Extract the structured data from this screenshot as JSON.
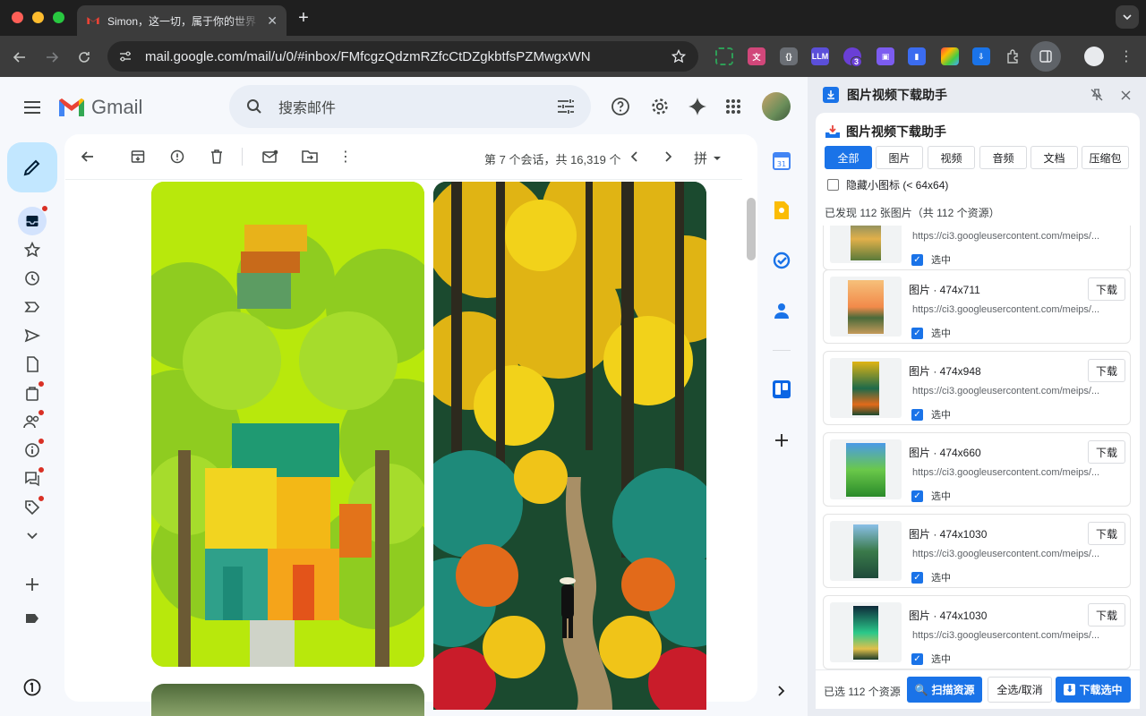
{
  "browser": {
    "tab_title": "Simon，这一切，属于你的世界",
    "url": "mail.google.com/mail/u/0/#inbox/FMfcgzQdzmRZfcCtDZgkbtfsPZMwgxWN",
    "extension_badge": "3"
  },
  "gmail": {
    "logo_text": "Gmail",
    "search_placeholder": "搜索邮件",
    "conversation_count": "第 7 个会话，共 16,319 个",
    "input_tool_label": "拼"
  },
  "panel": {
    "header_title": "图片视频下载助手",
    "title": "图片视频下载助手",
    "filters": [
      "全部",
      "图片",
      "视频",
      "音频",
      "文档",
      "压缩包"
    ],
    "hide_small_label": "隐藏小图标 (< 64x64)",
    "found_text": "已发现 112 张图片（共 112 个资源）",
    "download_label": "下载",
    "select_label": "选中",
    "items": [
      {
        "meta": "",
        "url": "https://ci3.googleusercontent.com/meips/..."
      },
      {
        "meta": "图片 · 474x711",
        "url": "https://ci3.googleusercontent.com/meips/..."
      },
      {
        "meta": "图片 · 474x948",
        "url": "https://ci3.googleusercontent.com/meips/..."
      },
      {
        "meta": "图片 · 474x660",
        "url": "https://ci3.googleusercontent.com/meips/..."
      },
      {
        "meta": "图片 · 474x1030",
        "url": "https://ci3.googleusercontent.com/meips/..."
      },
      {
        "meta": "图片 · 474x1030",
        "url": "https://ci3.googleusercontent.com/meips/..."
      }
    ],
    "footer": {
      "selected_count": "已选 112 个资源",
      "scan_label": "扫描资源",
      "toggle_all_label": "全选/取消",
      "download_selected_label": "下载选中"
    }
  },
  "colors": {
    "accent": "#1a73e8",
    "compose": "#c2e7ff",
    "badge": "#d93025"
  }
}
